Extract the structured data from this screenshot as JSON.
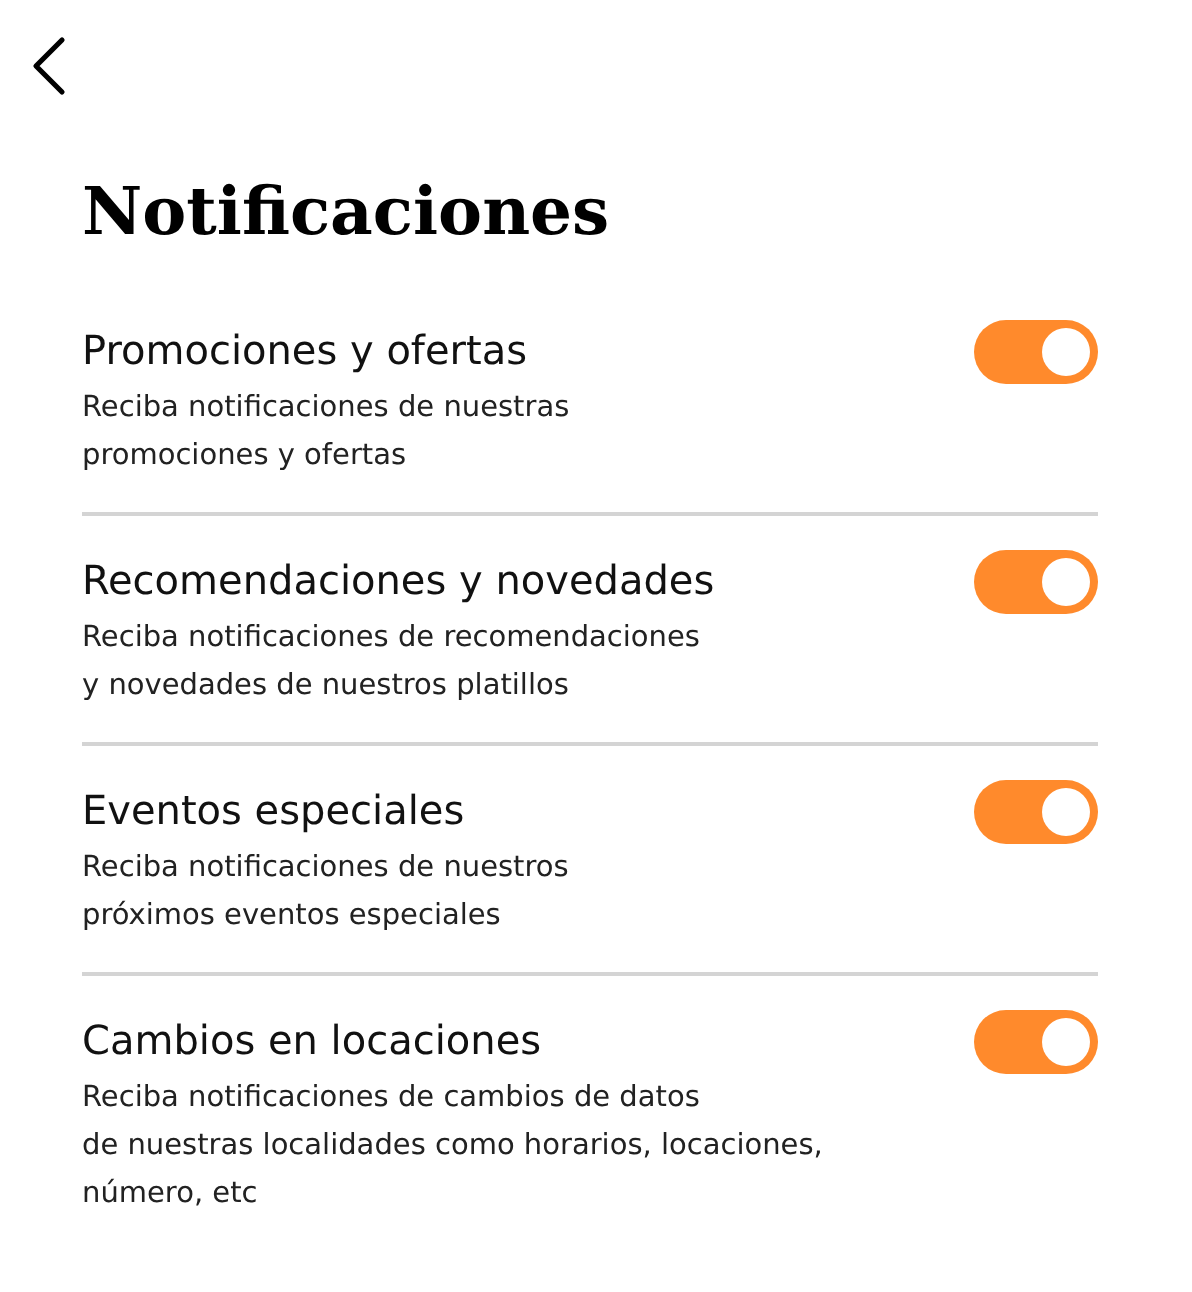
{
  "title": "Notificaciones",
  "settings": [
    {
      "title": "Promociones y ofertas",
      "description": "Reciba notificaciones de nuestras\npromociones y ofertas",
      "on": true
    },
    {
      "title": "Recomendaciones y novedades",
      "description": "Reciba notificaciones de recomendaciones\ny novedades de nuestros platillos",
      "on": true
    },
    {
      "title": "Eventos especiales",
      "description": "Reciba notificaciones de nuestros\npróximos eventos especiales",
      "on": true
    },
    {
      "title": "Cambios en locaciones",
      "description": "Reciba notificaciones de cambios de datos\nde nuestras localidades como horarios, locaciones,\nnúmero, etc",
      "on": true
    }
  ]
}
